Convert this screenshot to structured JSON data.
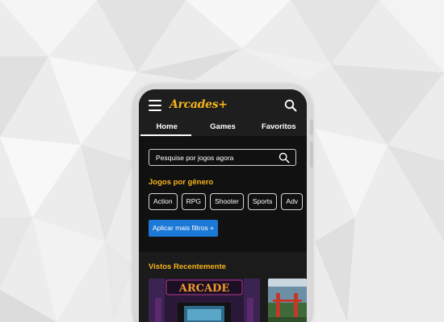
{
  "app": {
    "logo_text": "Arcades+",
    "brand_color": "#f6b51a",
    "accent_color": "#1b78d6"
  },
  "header": {
    "menu_icon": "hamburger-menu-icon",
    "search_icon": "search-icon"
  },
  "tabs": [
    {
      "label": "Home",
      "active": true
    },
    {
      "label": "Games",
      "active": false
    },
    {
      "label": "Favoritos",
      "active": false
    }
  ],
  "search": {
    "placeholder": "Pesquise por jogos agora",
    "value": ""
  },
  "genres": {
    "title": "Jogos por gênero",
    "chips": [
      "Action",
      "RPG",
      "Shooter",
      "Sports",
      "Adv"
    ]
  },
  "filters": {
    "apply_label": "Aplicar mais filtros +"
  },
  "recent": {
    "title": "Vistos Recentemente",
    "items": [
      {
        "sign_text": "ARCADE"
      },
      {
        "sign_text": ""
      }
    ]
  }
}
